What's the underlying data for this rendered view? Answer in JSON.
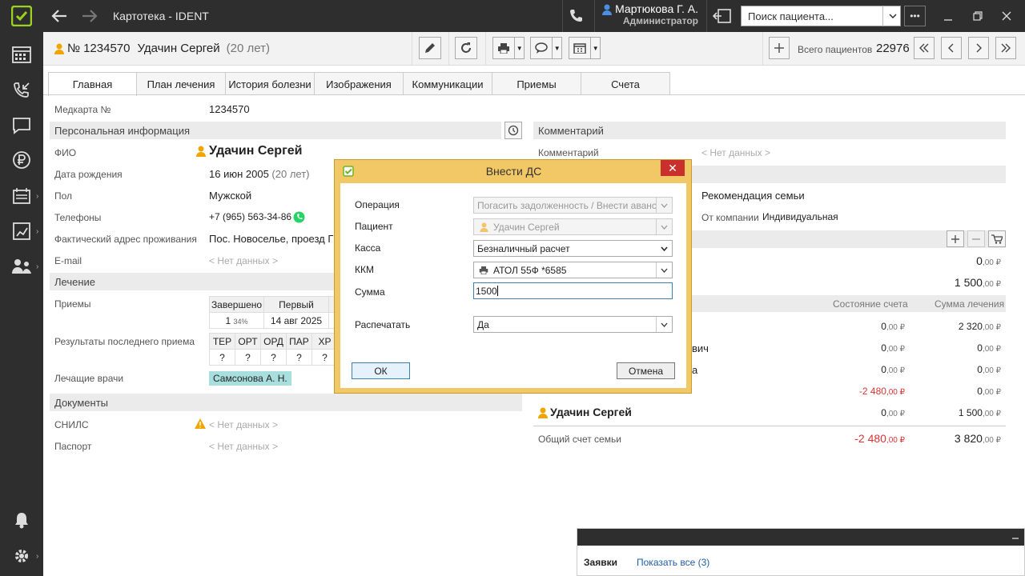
{
  "app": {
    "title": "Картотека - IDENT"
  },
  "user": {
    "name": "Мартюкова Г. А.",
    "role": "Администратор"
  },
  "search": {
    "placeholder": "Поиск пациента..."
  },
  "patient": {
    "card_prefix": "№",
    "card_no": "1234570",
    "name": "Удачин Сергей",
    "age": "(20 лет)"
  },
  "toolbar": {
    "total_label": "Всего пациентов",
    "total_value": "22976"
  },
  "tabs": [
    "Главная",
    "План лечения",
    "История болезни",
    "Изображения",
    "Коммуникации",
    "Приемы",
    "Счета"
  ],
  "left": {
    "medcard_label": "Медкарта №",
    "medcard_value": "1234570",
    "personal_section": "Персональная информация",
    "fio_label": "ФИО",
    "fio_value": "Удачин Сергей",
    "dob_label": "Дата рождения",
    "dob_value": "16 июн 2005",
    "dob_age": "(20 лет)",
    "sex_label": "Пол",
    "sex_value": "Мужской",
    "phone_label": "Телефоны",
    "phone_value": "+7 (965) 563-34-86",
    "address_label": "Фактический адрес проживания",
    "address_value": "Пос. Новоселье, проезд Г",
    "email_label": "E-mail",
    "email_value": "< Нет данных >",
    "treatment_section": "Лечение",
    "visits_label": "Приемы",
    "visits_headers": [
      "Завершено",
      "Первый"
    ],
    "visits_values": [
      "1",
      "34%",
      "14 авг 2025"
    ],
    "results_label": "Результаты последнего приема",
    "results_headers": [
      "ТЕР",
      "ОРТ",
      "ОРД",
      "ПАР",
      "ХР"
    ],
    "results_values": [
      "?",
      "?",
      "?",
      "?",
      "?"
    ],
    "doctors_label": "Лечащие врачи",
    "doctor": "Самсонова А. Н.",
    "docs_section": "Документы",
    "snils_label": "СНИЛС",
    "snils_value": "< Нет данных >",
    "passport_label": "Паспорт",
    "passport_value": "< Нет данных >"
  },
  "right": {
    "comment_section": "Комментарий",
    "comment_label": "Комментарий",
    "comment_value": "< Нет данных >",
    "recommend": "Рекомендация семьи",
    "company_label": "От компании",
    "company_value": "Индивидуальная",
    "balance1": {
      "int": "0",
      "dec": ",00 ₽"
    },
    "balance2": {
      "int": "1 500",
      "dec": ",00 ₽"
    },
    "col_state": "Состояние счета",
    "col_sum": "Сумма лечения",
    "rows": [
      {
        "name": "",
        "state_int": "0",
        "state_dec": ",00 ₽",
        "sum_int": "2 320",
        "sum_dec": ",00 ₽"
      },
      {
        "name": "вич",
        "state_int": "0",
        "state_dec": ",00 ₽",
        "sum_int": "0",
        "sum_dec": ",00 ₽"
      },
      {
        "name": "а",
        "state_int": "0",
        "state_dec": ",00 ₽",
        "sum_int": "0",
        "sum_dec": ",00 ₽"
      },
      {
        "name": "",
        "state_int": "-2 480",
        "state_dec": ",00 ₽",
        "sum_int": "0",
        "sum_dec": ",00 ₽"
      },
      {
        "name": "Удачин Сергей",
        "state_int": "0",
        "state_dec": ",00 ₽",
        "sum_int": "1 500",
        "sum_dec": ",00 ₽"
      }
    ],
    "family_label": "Общий счет семьи",
    "family_state": {
      "int": "-2 480",
      "dec": ",00 ₽"
    },
    "family_sum": {
      "int": "3 820",
      "dec": ",00 ₽"
    }
  },
  "modal": {
    "title": "Внести ДС",
    "operation_label": "Операция",
    "operation_value": "Погасить задолженность / Внести аванс",
    "patient_label": "Пациент",
    "patient_value": "Удачин Сергей",
    "cash_label": "Касса",
    "cash_value": "Безналичный расчет",
    "kkm_label": "ККМ",
    "kkm_value": "АТОЛ 55Ф *6585",
    "sum_label": "Сумма",
    "sum_value": "1500",
    "print_label": "Распечатать",
    "print_value": "Да",
    "ok": "ОК",
    "cancel": "Отмена"
  },
  "notifications": {
    "title": "Заявки",
    "link": "Показать все (3)"
  },
  "colors": {
    "accent": "#9bd21f",
    "modal_frame": "#f2c766",
    "close": "#c9302c",
    "negative": "#d33333",
    "person_icon": "#f0a500"
  }
}
